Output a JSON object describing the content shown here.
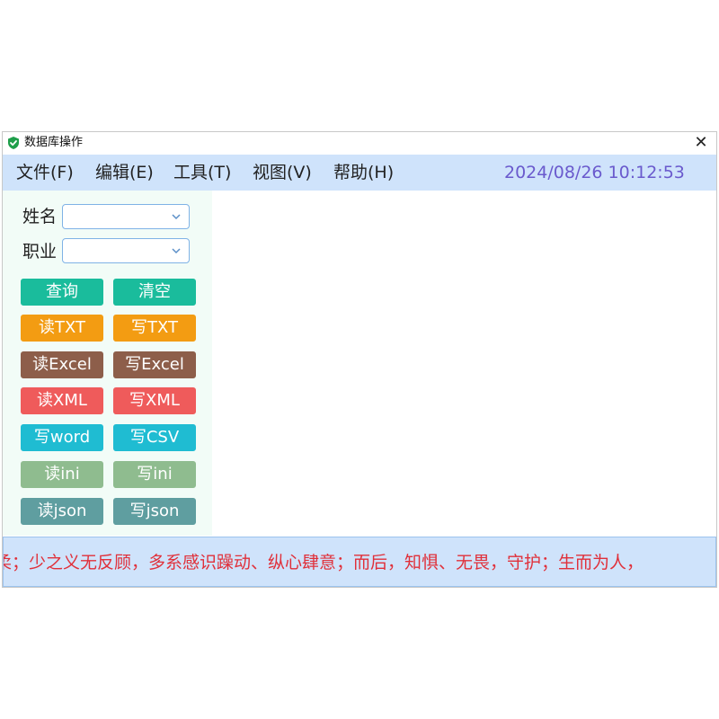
{
  "window": {
    "title": "数据库操作",
    "close_glyph": "✕",
    "icon": "shield-check-icon"
  },
  "menu": {
    "items": [
      "文件(F)",
      "编辑(E)",
      "工具(T)",
      "视图(V)",
      "帮助(H)"
    ],
    "datetime": "2024/08/26 10:12:53"
  },
  "form": {
    "name_label": "姓名",
    "name_value": "",
    "job_label": "职业",
    "job_value": ""
  },
  "buttons": [
    {
      "label": "查询",
      "color": "#1abc9c"
    },
    {
      "label": "清空",
      "color": "#1abc9c"
    },
    {
      "label": "读TXT",
      "color": "#f39c12"
    },
    {
      "label": "写TXT",
      "color": "#f39c12"
    },
    {
      "label": "读Excel",
      "color": "#8d5e4a"
    },
    {
      "label": "写Excel",
      "color": "#8d5e4a"
    },
    {
      "label": "读XML",
      "color": "#ef5b5b"
    },
    {
      "label": "写XML",
      "color": "#ef5b5b"
    },
    {
      "label": "写word",
      "color": "#1fbcd2"
    },
    {
      "label": "写CSV",
      "color": "#1fbcd2"
    },
    {
      "label": "读ini",
      "color": "#8fbc8f"
    },
    {
      "label": "写ini",
      "color": "#8fbc8f"
    },
    {
      "label": "读json",
      "color": "#5f9ea0"
    },
    {
      "label": "写json",
      "color": "#5f9ea0"
    }
  ],
  "marquee": {
    "text": "柔；少之义无反顾，多系感识躁动、纵心肆意；而后，知惧、无畏，守护；生而为人，"
  },
  "colors": {
    "menubar": "#cfe3fb",
    "datetime": "#6a5acd",
    "marquee_text": "#e0303a",
    "panel": "#f2fcf7"
  }
}
